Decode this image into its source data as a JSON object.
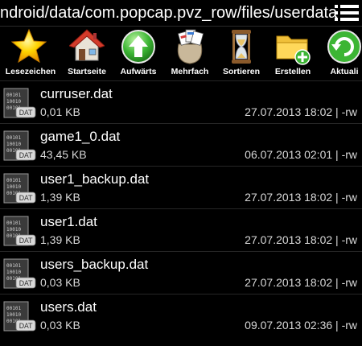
{
  "path": "ndroid/data/com.popcap.pvz_row/files/userdata",
  "menu_icon": "overflow-menu-icon",
  "toolbar": [
    {
      "label": "Lesezeichen",
      "icon": "star-icon"
    },
    {
      "label": "Startseite",
      "icon": "home-icon"
    },
    {
      "label": "Aufwärts",
      "icon": "up-arrow-icon"
    },
    {
      "label": "Mehrfach",
      "icon": "multi-select-bag-icon"
    },
    {
      "label": "Sortieren",
      "icon": "hourglass-icon"
    },
    {
      "label": "Erstellen",
      "icon": "new-folder-icon"
    },
    {
      "label": "Aktuali",
      "icon": "refresh-icon"
    }
  ],
  "file_icon_badge": "DAT",
  "files": [
    {
      "name": "curruser.dat",
      "size": "0,01 KB",
      "meta": "27.07.2013 18:02 | -rw"
    },
    {
      "name": "game1_0.dat",
      "size": "43,45 KB",
      "meta": "06.07.2013 02:01 | -rw"
    },
    {
      "name": "user1_backup.dat",
      "size": "1,39 KB",
      "meta": "27.07.2013 18:02 | -rw"
    },
    {
      "name": "user1.dat",
      "size": "1,39 KB",
      "meta": "27.07.2013 18:02 | -rw"
    },
    {
      "name": "users_backup.dat",
      "size": "0,03 KB",
      "meta": "27.07.2013 18:02 | -rw"
    },
    {
      "name": "users.dat",
      "size": "0,03 KB",
      "meta": "09.07.2013 02:36 | -rw"
    }
  ],
  "colors": {
    "background": "#000000",
    "text": "#ffffff",
    "subtext": "#d8d8d8"
  }
}
